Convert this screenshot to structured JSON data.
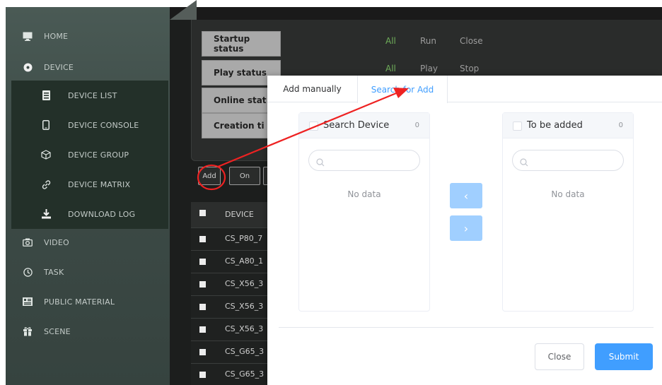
{
  "sidebar": {
    "items": [
      {
        "label": "HOME",
        "icon": "monitor-icon"
      },
      {
        "label": "DEVICE",
        "icon": "disc-icon"
      },
      {
        "label": "DEVICE LIST",
        "icon": "list-doc-icon"
      },
      {
        "label": "DEVICE CONSOLE",
        "icon": "phone-icon"
      },
      {
        "label": "DEVICE GROUP",
        "icon": "cube-icon"
      },
      {
        "label": "DEVICE MATRIX",
        "icon": "link-icon"
      },
      {
        "label": "DOWNLOAD LOG",
        "icon": "download-icon"
      },
      {
        "label": "VIDEO",
        "icon": "camera-icon"
      },
      {
        "label": "TASK",
        "icon": "clock-icon"
      },
      {
        "label": "PUBLIC MATERIAL",
        "icon": "media-icon"
      },
      {
        "label": "SCENE",
        "icon": "gift-icon"
      }
    ]
  },
  "filters": {
    "startup": {
      "label": "Startup status",
      "options": [
        "All",
        "Run",
        "Close"
      ]
    },
    "play": {
      "label": "Play status",
      "options": [
        "All",
        "Play",
        "Stop"
      ]
    },
    "online": {
      "label": "Online stat"
    },
    "creation": {
      "label": "Creation ti"
    }
  },
  "toolbar": {
    "add": "Add",
    "on": "On"
  },
  "table": {
    "header": "DEVICE",
    "rows": [
      "CS_P80_7",
      "CS_A80_1",
      "CS_X56_3",
      "CS_X56_3",
      "CS_X56_3",
      "CS_G65_3",
      "CS_G65_3"
    ]
  },
  "modal": {
    "tabs": [
      "Add manually",
      "Search for Add"
    ],
    "left_panel": {
      "title": "Search Device",
      "count": "0",
      "empty": "No data",
      "placeholder": ""
    },
    "right_panel": {
      "title": "To be added",
      "count": "0",
      "empty": "No data",
      "placeholder": ""
    },
    "arrow_left": "‹",
    "arrow_right": "›",
    "close": "Close",
    "submit": "Submit"
  },
  "colors": {
    "accent": "#409eff",
    "annotation": "#ee2222",
    "active_option": "#6fae5a"
  }
}
